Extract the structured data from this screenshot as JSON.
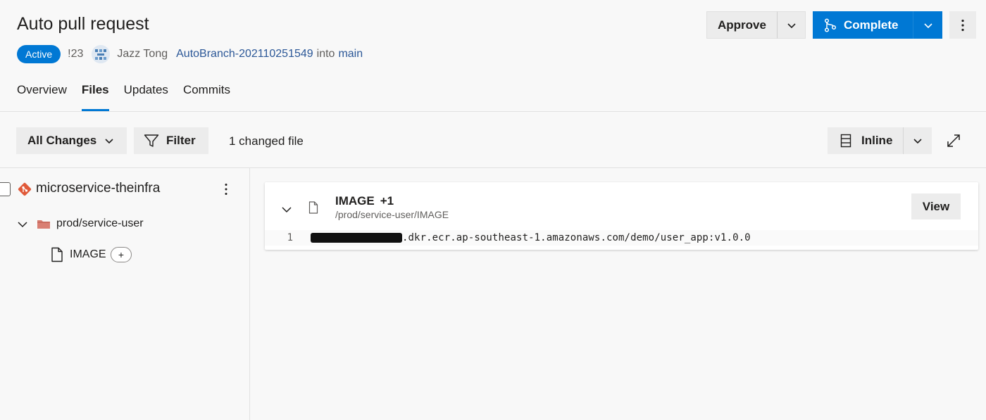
{
  "header": {
    "title": "Auto pull request",
    "status": "Active",
    "pr_id": "!23",
    "author": "Jazz Tong",
    "source_branch": "AutoBranch-202110251549",
    "into": "into",
    "target_branch": "main"
  },
  "actions": {
    "approve_label": "Approve",
    "complete_label": "Complete"
  },
  "tabs": [
    {
      "label": "Overview",
      "active": false
    },
    {
      "label": "Files",
      "active": true
    },
    {
      "label": "Updates",
      "active": false
    },
    {
      "label": "Commits",
      "active": false
    }
  ],
  "toolbar": {
    "all_changes_label": "All Changes",
    "filter_label": "Filter",
    "changed_files": "1 changed file",
    "view_mode_label": "Inline"
  },
  "tree": {
    "repo_name": "microservice-theinfra",
    "folder_name": "prod/service-user",
    "file_name": "IMAGE",
    "file_badge": "+"
  },
  "file_card": {
    "file_name": "IMAGE",
    "delta": "+1",
    "path": "/prod/service-user/IMAGE",
    "view_label": "View",
    "lines": [
      {
        "number": "1",
        "code": ".dkr.ecr.ap-southeast-1.amazonaws.com/demo/user_app:v1.0.0"
      }
    ]
  },
  "colors": {
    "accent": "#0078d4",
    "repo_icon": "#e05a3a",
    "folder_icon": "#d46a5c"
  },
  "icons": [
    "chevron-down-icon",
    "branch-merge-icon",
    "more-vertical-icon",
    "filter-icon",
    "inline-view-icon",
    "expand-icon",
    "git-repo-icon",
    "folder-icon",
    "file-icon"
  ]
}
